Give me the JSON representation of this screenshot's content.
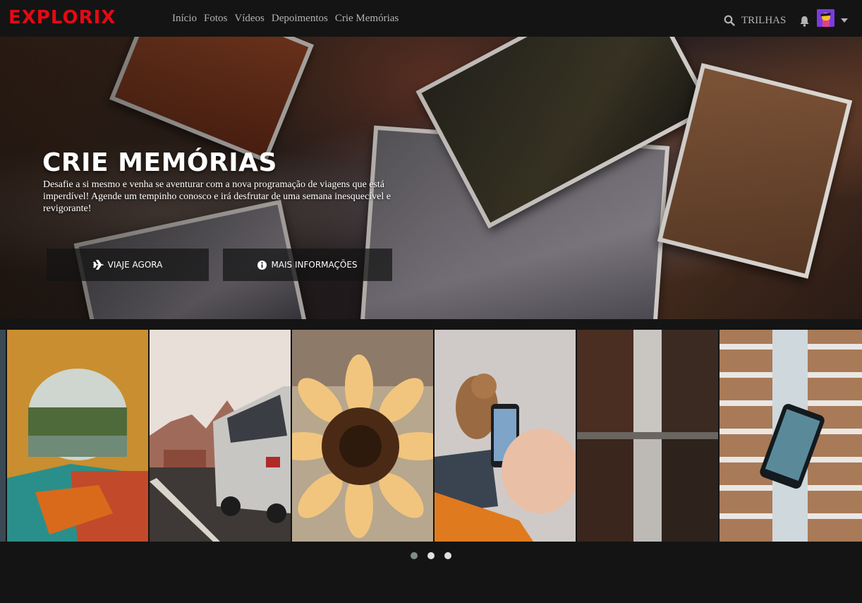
{
  "brand": {
    "logo": "EXPLORIX",
    "color": "#e50914"
  },
  "nav": {
    "items": [
      "Início",
      "Fotos",
      "Vídeos",
      "Depoimentos",
      "Crie Memórias"
    ]
  },
  "tools": {
    "search_icon": "search-icon",
    "trilhas_label": "TRILHAS",
    "notification_icon": "bell-icon",
    "profile_menu_icon": "caret-down-icon"
  },
  "hero": {
    "title": "CRIE MEMÓRIAS",
    "description": "Desafie a si mesmo e venha se aventurar com a nova programação de viagens que está imperdível! Agende um tempinho conosco e irá desfrutar de uma semana inesquecível e revigorante!",
    "primary_button": {
      "label": "VIAJE AGORA",
      "icon": "plane-icon"
    },
    "secondary_button": {
      "label": "MAIS INFORMAÇÕES",
      "icon": "info-icon"
    }
  },
  "carousel": {
    "thumbnails": [
      "tent-view",
      "van-mountains",
      "sunflower",
      "dog-phone",
      "city-reflection",
      "phone-building"
    ],
    "page_count": 3,
    "active_page": 1
  }
}
